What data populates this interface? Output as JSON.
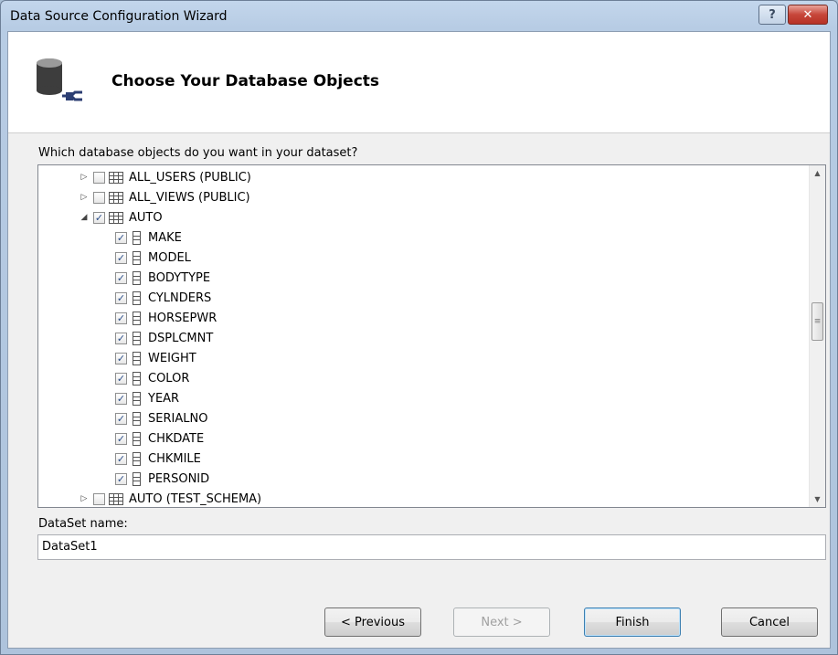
{
  "window": {
    "title": "Data Source Configuration Wizard"
  },
  "header": {
    "title": "Choose Your Database Objects",
    "icon": "database-connect-icon"
  },
  "prompt": {
    "label": "Which database objects do you want in your dataset?"
  },
  "tree": {
    "rows": [
      {
        "level": 0,
        "expander": "collapsed",
        "checked": false,
        "icon": "table-icon",
        "label": "ALL_USERS (PUBLIC)"
      },
      {
        "level": 0,
        "expander": "collapsed",
        "checked": false,
        "icon": "table-icon",
        "label": "ALL_VIEWS (PUBLIC)"
      },
      {
        "level": 0,
        "expander": "expanded",
        "checked": true,
        "icon": "table-icon",
        "label": "AUTO"
      },
      {
        "level": 1,
        "checked": true,
        "icon": "column-icon",
        "label": "MAKE"
      },
      {
        "level": 1,
        "checked": true,
        "icon": "column-icon",
        "label": "MODEL"
      },
      {
        "level": 1,
        "checked": true,
        "icon": "column-icon",
        "label": "BODYTYPE"
      },
      {
        "level": 1,
        "checked": true,
        "icon": "column-icon",
        "label": "CYLNDERS"
      },
      {
        "level": 1,
        "checked": true,
        "icon": "column-icon",
        "label": "HORSEPWR"
      },
      {
        "level": 1,
        "checked": true,
        "icon": "column-icon",
        "label": "DSPLCMNT"
      },
      {
        "level": 1,
        "checked": true,
        "icon": "column-icon",
        "label": "WEIGHT"
      },
      {
        "level": 1,
        "checked": true,
        "icon": "column-icon",
        "label": "COLOR"
      },
      {
        "level": 1,
        "checked": true,
        "icon": "column-icon",
        "label": "YEAR"
      },
      {
        "level": 1,
        "checked": true,
        "icon": "column-icon",
        "label": "SERIALNO"
      },
      {
        "level": 1,
        "checked": true,
        "icon": "column-icon",
        "label": "CHKDATE"
      },
      {
        "level": 1,
        "checked": true,
        "icon": "column-icon",
        "label": "CHKMILE"
      },
      {
        "level": 1,
        "checked": true,
        "icon": "column-icon",
        "label": "PERSONID"
      },
      {
        "level": 0,
        "expander": "collapsed",
        "checked": false,
        "icon": "table-icon",
        "label": "AUTO (TEST_SCHEMA)"
      }
    ]
  },
  "dataset": {
    "label": "DataSet name:",
    "value": "DataSet1"
  },
  "buttons": {
    "previous": "< Previous",
    "next": "Next >",
    "finish": "Finish",
    "cancel": "Cancel"
  }
}
